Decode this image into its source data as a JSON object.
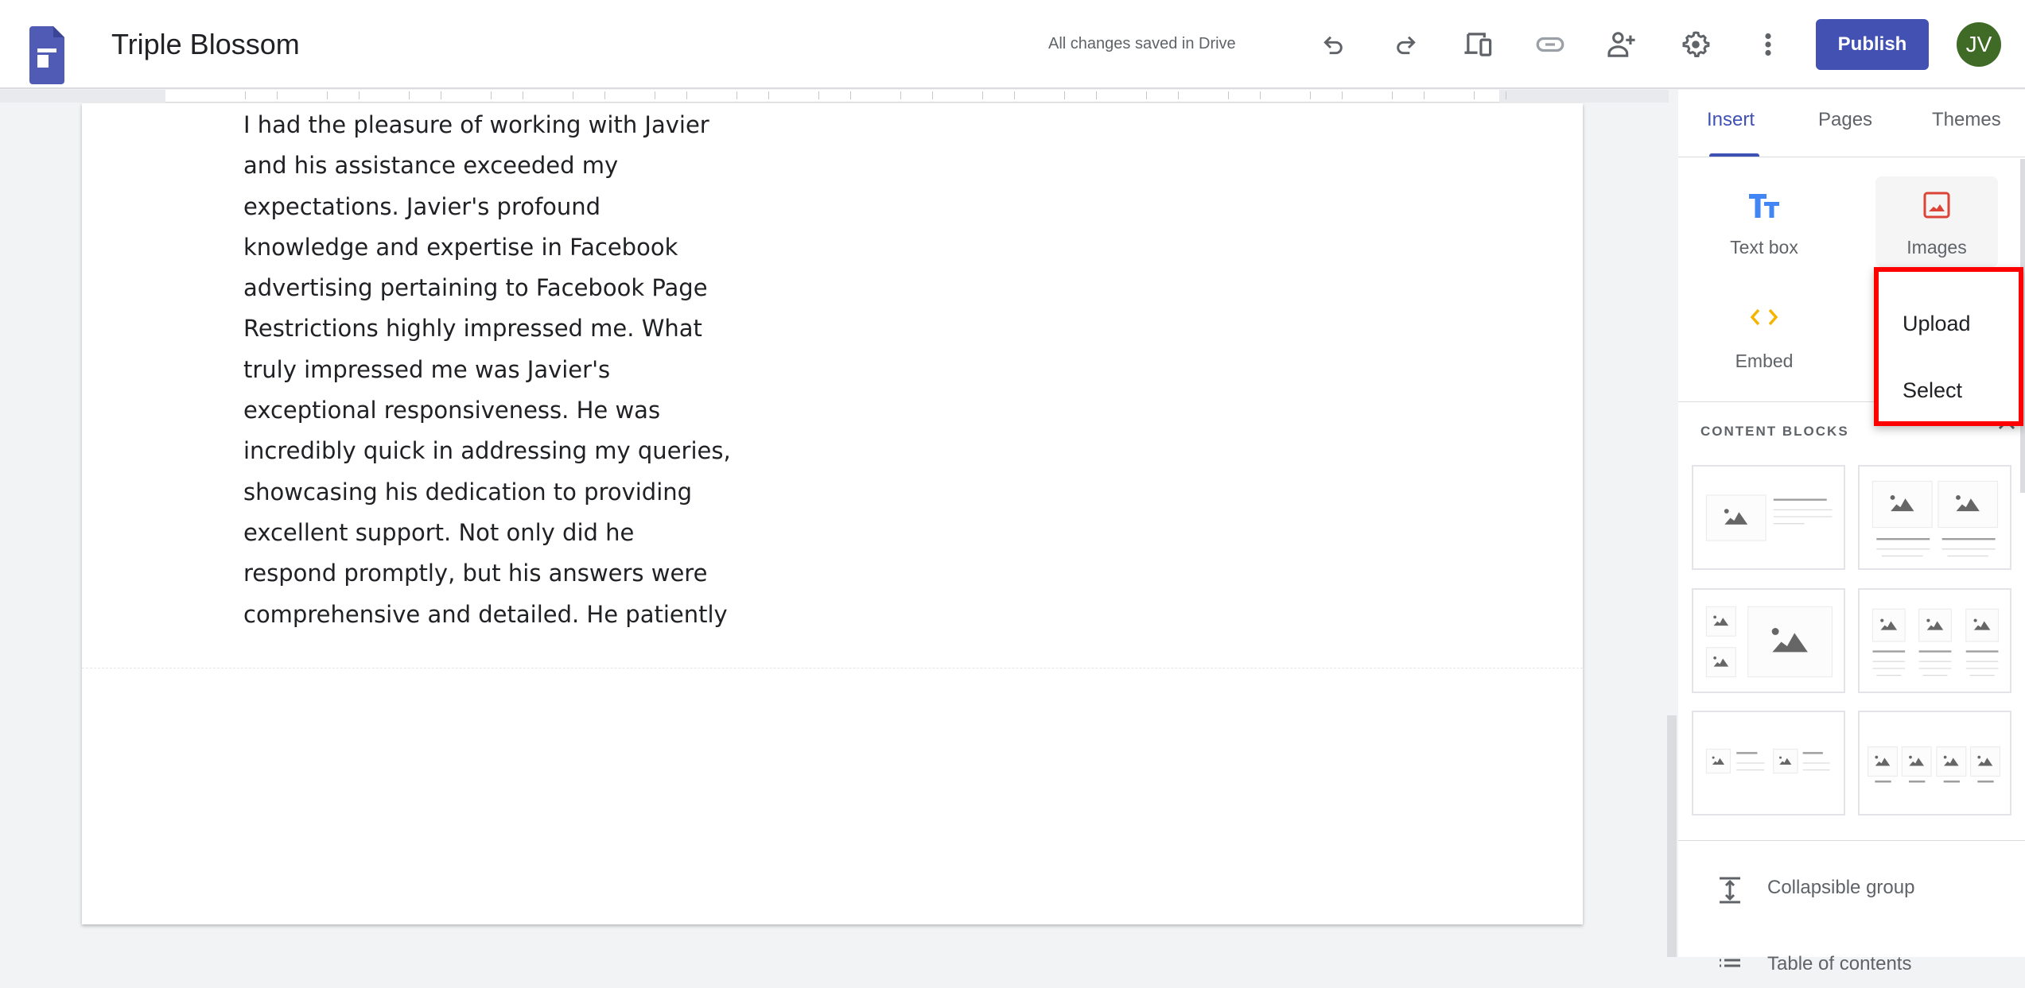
{
  "header": {
    "title": "Triple Blossom",
    "save_status": "All changes saved in Drive",
    "publish_label": "Publish",
    "avatar_initials": "JV",
    "icons": [
      "undo-icon",
      "redo-icon",
      "preview-icon",
      "link-icon",
      "share-icon",
      "settings-icon",
      "more-icon"
    ]
  },
  "document": {
    "lines": [
      "I had the pleasure of working with Javier",
      "and his assistance exceeded my",
      "expectations. Javier's profound",
      "knowledge and expertise in Facebook",
      "advertising pertaining to Facebook Page",
      "Restrictions highly impressed me. What",
      "truly impressed me was Javier's",
      "exceptional responsiveness. He was",
      "incredibly quick in addressing my queries,",
      "showcasing his dedication to providing",
      "excellent support. Not only did he",
      "respond promptly, but his answers were",
      "comprehensive and detailed. He patiently"
    ]
  },
  "panel": {
    "tabs": [
      {
        "label": "Insert",
        "active": true
      },
      {
        "label": "Pages"
      },
      {
        "label": "Themes"
      }
    ],
    "insert": {
      "text_box": "Text box",
      "images": "Images",
      "embed": "Embed"
    },
    "images_menu": {
      "upload": "Upload",
      "select": "Select"
    },
    "content_blocks_label": "CONTENT BLOCKS",
    "items": {
      "collapsible": "Collapsible group",
      "toc": "Table of contents"
    },
    "colors": {
      "accent": "#3f51b5",
      "publish": "#4352b2",
      "textbox_icon": "#4285f4",
      "images_icon": "#db4437",
      "embed_icon": "#f4b400",
      "highlight": "#ff0000"
    }
  }
}
